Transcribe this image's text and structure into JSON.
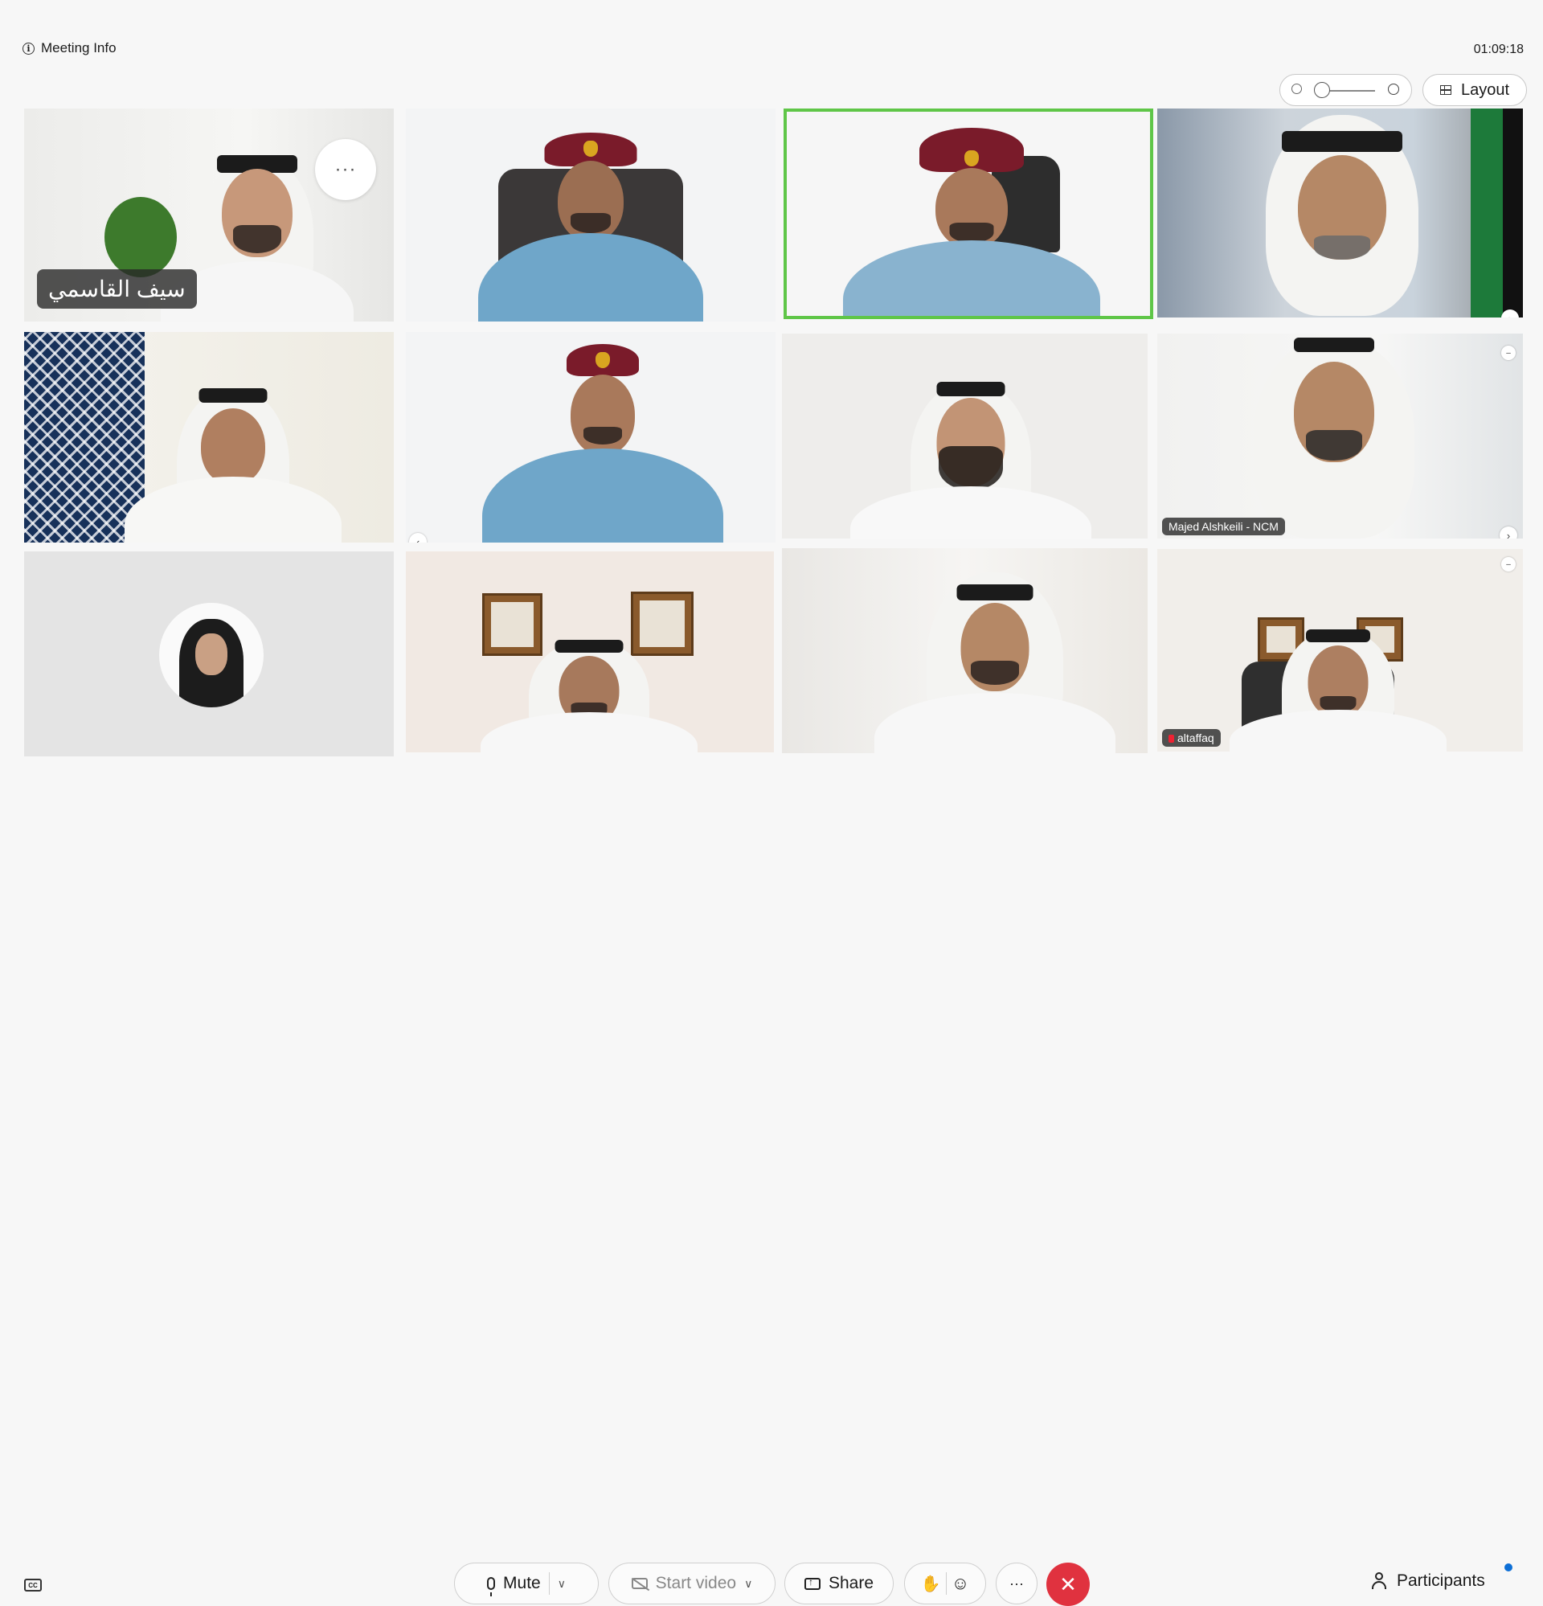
{
  "header": {
    "meeting_info_label": "Meeting Info",
    "timer": "01:09:18",
    "layout_label": "Layout"
  },
  "participants": [
    {
      "name": "سيف القاسمي",
      "show_name": true,
      "selected": true,
      "kind": "ghutra"
    },
    {
      "name": "",
      "show_name": false,
      "selected": true,
      "kind": "uniform"
    },
    {
      "name": "",
      "show_name": false,
      "active_speaker": true,
      "kind": "uniform"
    },
    {
      "name": "",
      "show_name": false,
      "kind": "ghutra"
    },
    {
      "name": "",
      "show_name": false,
      "selected": true,
      "kind": "ghutra"
    },
    {
      "name": "",
      "show_name": false,
      "selected": true,
      "kind": "uniform"
    },
    {
      "name": "",
      "show_name": false,
      "kind": "ghutra"
    },
    {
      "name": "Majed Alshkeili - NCM",
      "show_name": true,
      "kind": "ghutra"
    },
    {
      "name": "",
      "show_name": false,
      "kind": "avatar"
    },
    {
      "name": "",
      "show_name": false,
      "kind": "ghutra"
    },
    {
      "name": "",
      "show_name": false,
      "kind": "ghutra"
    },
    {
      "name": "altaffaq",
      "show_name": true,
      "muted_indicator": true,
      "kind": "ghutra"
    }
  ],
  "controls": {
    "mute_label": "Mute",
    "start_video_label": "Start video",
    "share_label": "Share",
    "more_label": "···",
    "end_label": "✕",
    "participants_label": "Participants"
  },
  "icons": {
    "info": "info-icon",
    "zoom_out": "zoom-out-icon",
    "zoom_in": "zoom-in-icon",
    "layout": "grid-icon",
    "captions": "closed-captions-icon",
    "mic": "microphone-icon",
    "camera_off": "camera-off-icon",
    "share": "share-screen-icon",
    "raise_hand": "raise-hand-icon",
    "reactions": "emoji-reaction-icon",
    "end": "end-call-icon",
    "participants": "participants-icon"
  },
  "colors": {
    "active_speaker_border": "#5fc648",
    "selected_border": "#5ec3dc",
    "end_call": "#e0323f",
    "notification": "#0d6fd6"
  }
}
